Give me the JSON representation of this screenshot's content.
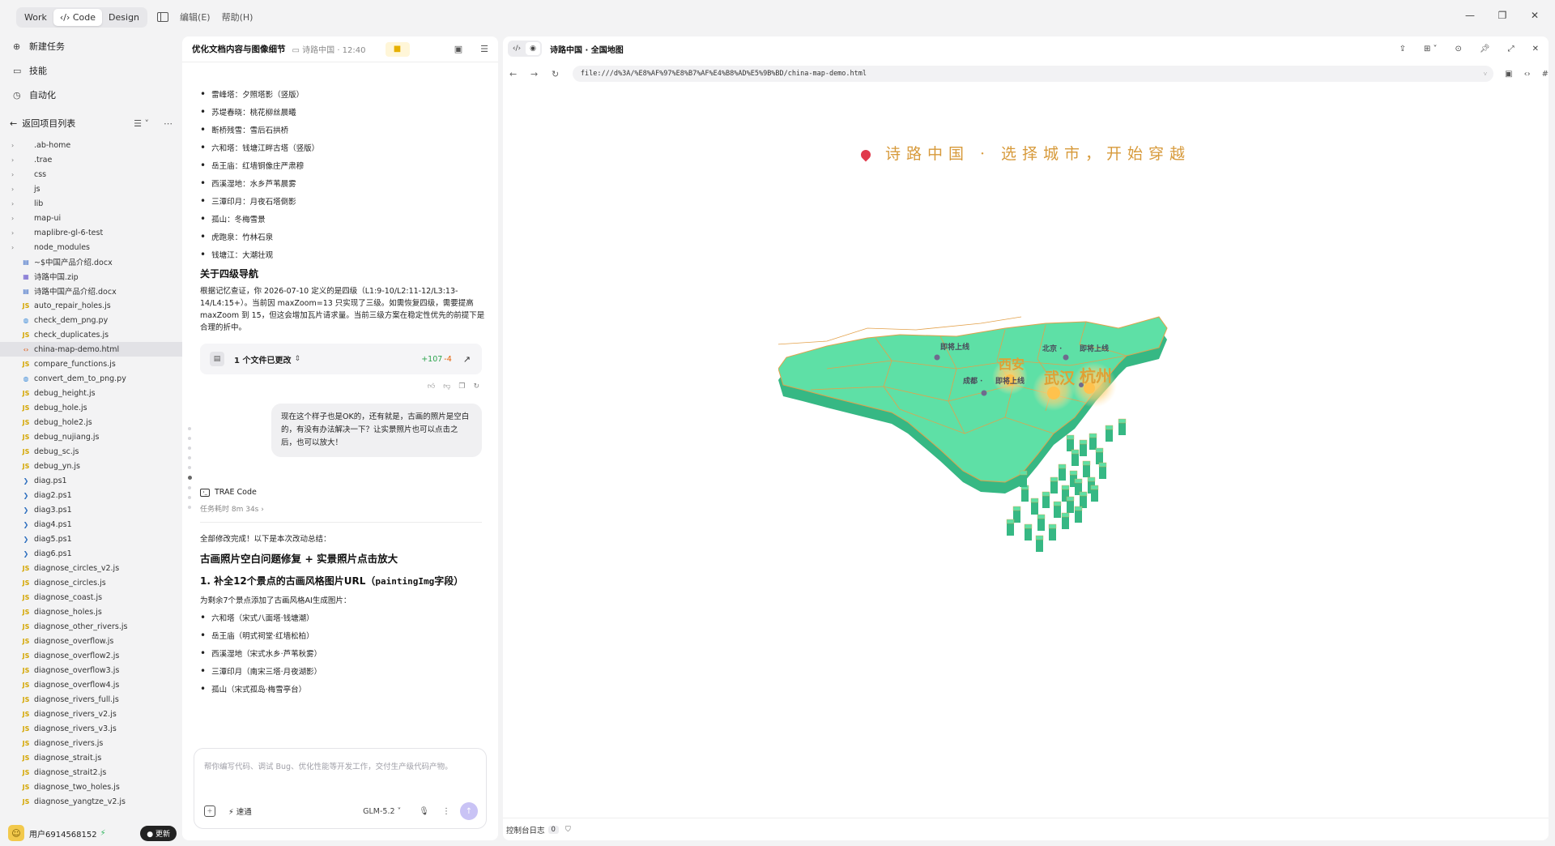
{
  "titlebar": {
    "modes": [
      "Work",
      "Code",
      "Design"
    ],
    "active_mode": "Code",
    "menus": [
      "编辑(E)",
      "帮助(H)"
    ]
  },
  "sidebar": {
    "nav": [
      {
        "label": "新建任务",
        "icon": "new-task-icon"
      },
      {
        "label": "技能",
        "icon": "book-icon"
      },
      {
        "label": "自动化",
        "icon": "clock-icon"
      }
    ],
    "back_label": "返回项目列表",
    "tree": [
      {
        "name": ".ab-home",
        "type": "folder"
      },
      {
        "name": ".trae",
        "type": "folder"
      },
      {
        "name": "css",
        "type": "folder"
      },
      {
        "name": "js",
        "type": "folder"
      },
      {
        "name": "lib",
        "type": "folder"
      },
      {
        "name": "map-ui",
        "type": "folder"
      },
      {
        "name": "maplibre-gl-6-test",
        "type": "folder"
      },
      {
        "name": "node_modules",
        "type": "folder"
      },
      {
        "name": "~$中国产品介绍.docx",
        "type": "doc"
      },
      {
        "name": "诗路中国.zip",
        "type": "zip"
      },
      {
        "name": "诗路中国产品介绍.docx",
        "type": "doc"
      },
      {
        "name": "auto_repair_holes.js",
        "type": "js"
      },
      {
        "name": "check_dem_png.py",
        "type": "py"
      },
      {
        "name": "check_duplicates.js",
        "type": "js"
      },
      {
        "name": "china-map-demo.html",
        "type": "html",
        "selected": true
      },
      {
        "name": "compare_functions.js",
        "type": "js"
      },
      {
        "name": "convert_dem_to_png.py",
        "type": "py"
      },
      {
        "name": "debug_height.js",
        "type": "js"
      },
      {
        "name": "debug_hole.js",
        "type": "js"
      },
      {
        "name": "debug_hole2.js",
        "type": "js"
      },
      {
        "name": "debug_nujiang.js",
        "type": "js"
      },
      {
        "name": "debug_sc.js",
        "type": "js"
      },
      {
        "name": "debug_yn.js",
        "type": "js"
      },
      {
        "name": "diag.ps1",
        "type": "ps"
      },
      {
        "name": "diag2.ps1",
        "type": "ps"
      },
      {
        "name": "diag3.ps1",
        "type": "ps"
      },
      {
        "name": "diag4.ps1",
        "type": "ps"
      },
      {
        "name": "diag5.ps1",
        "type": "ps"
      },
      {
        "name": "diag6.ps1",
        "type": "ps"
      },
      {
        "name": "diagnose_circles_v2.js",
        "type": "js"
      },
      {
        "name": "diagnose_circles.js",
        "type": "js"
      },
      {
        "name": "diagnose_coast.js",
        "type": "js"
      },
      {
        "name": "diagnose_holes.js",
        "type": "js"
      },
      {
        "name": "diagnose_other_rivers.js",
        "type": "js"
      },
      {
        "name": "diagnose_overflow.js",
        "type": "js"
      },
      {
        "name": "diagnose_overflow2.js",
        "type": "js"
      },
      {
        "name": "diagnose_overflow3.js",
        "type": "js"
      },
      {
        "name": "diagnose_overflow4.js",
        "type": "js"
      },
      {
        "name": "diagnose_rivers_full.js",
        "type": "js"
      },
      {
        "name": "diagnose_rivers_v2.js",
        "type": "js"
      },
      {
        "name": "diagnose_rivers_v3.js",
        "type": "js"
      },
      {
        "name": "diagnose_rivers.js",
        "type": "js"
      },
      {
        "name": "diagnose_strait.js",
        "type": "js"
      },
      {
        "name": "diagnose_strait2.js",
        "type": "js"
      },
      {
        "name": "diagnose_two_holes.js",
        "type": "js"
      },
      {
        "name": "diagnose_yangtze_v2.js",
        "type": "js"
      }
    ],
    "user": {
      "name": "用户6914568152",
      "update_label": "更新"
    }
  },
  "chat": {
    "title": "优化文档内容与图像细节",
    "subtitle": "诗路中国 · 12:40",
    "top_list": [
      "雷峰塔：夕照塔影（竖版）",
      "苏堤春晓：桃花柳丝晨曦",
      "断桥残雪：雪后石拱桥",
      "六和塔：钱塘江畔古塔（竖版）",
      "岳王庙：红墙铜像庄严肃穆",
      "西溪湿地：水乡芦苇晨雾",
      "三潭印月：月夜石塔倒影",
      "孤山：冬梅雪景",
      "虎跑泉：竹林石泉",
      "钱塘江：大潮壮观"
    ],
    "nav_heading": "关于四级导航",
    "nav_para": "根据记忆查证，你 2026-07-10 定义的是四级（L1:9-10/L2:11-12/L3:13-14/L4:15+）。当前因 maxZoom=13 只实现了三级。如需恢复四级，需要提高 maxZoom 到 15，但这会增加瓦片请求量。当前三级方案在稳定性优先的前提下是合理的折中。",
    "file_card": {
      "label": "1 个文件已更改",
      "added": "+107",
      "removed": "-4"
    },
    "user_message": "现在这个样子也是OK的，还有就是，古画的照片是空白的，有没有办法解决一下？让实景照片也可以点击之后，也可以放大！",
    "agent_name": "TRAE Code",
    "elapsed": "任务耗时 8m 34s",
    "summary_intro": "全部修改完成！以下是本次改动总结：",
    "section_title": "古画照片空白问题修复 + 实景照片点击放大",
    "subsection_prefix": "1. 补全12个景点的古画风格图片URL（",
    "subsection_code": "paintingImg",
    "subsection_suffix": "字段）",
    "subsection_intro": "为剩余7个景点添加了古画风格AI生成图片：",
    "bottom_list": [
      "六和塔（宋式八面塔·钱塘潮）",
      "岳王庙（明式祠堂·红墙松柏）",
      "西溪湿地（宋式水乡·芦苇秋雾）",
      "三潭印月（南宋三塔·月夜湖影）",
      "孤山（宋式孤岛·梅雪亭台）"
    ],
    "input_placeholder": "帮你编写代码、调试 Bug、优化性能等开发工作，交付生产级代码产物。",
    "speed_label": "速通",
    "model_label": "GLM-5.2"
  },
  "browser": {
    "title": "诗路中国 · 全国地图",
    "url": "file:///d%3A/%E8%AF%97%E8%B7%AF%E4%B8%AD%E5%9B%BD/china-map-demo.html",
    "page_title": "诗路中国 · 选择城市，开始穿越",
    "map": {
      "fill": "#5ee0a6",
      "side": "#36b884",
      "border": "#e3a14a",
      "cities_big": [
        "西安",
        "武汉",
        "杭州"
      ],
      "cities_small": [
        "北京",
        "成都"
      ],
      "coming_soon": "即将上线"
    },
    "console_label": "控制台日志",
    "console_count": "0"
  }
}
